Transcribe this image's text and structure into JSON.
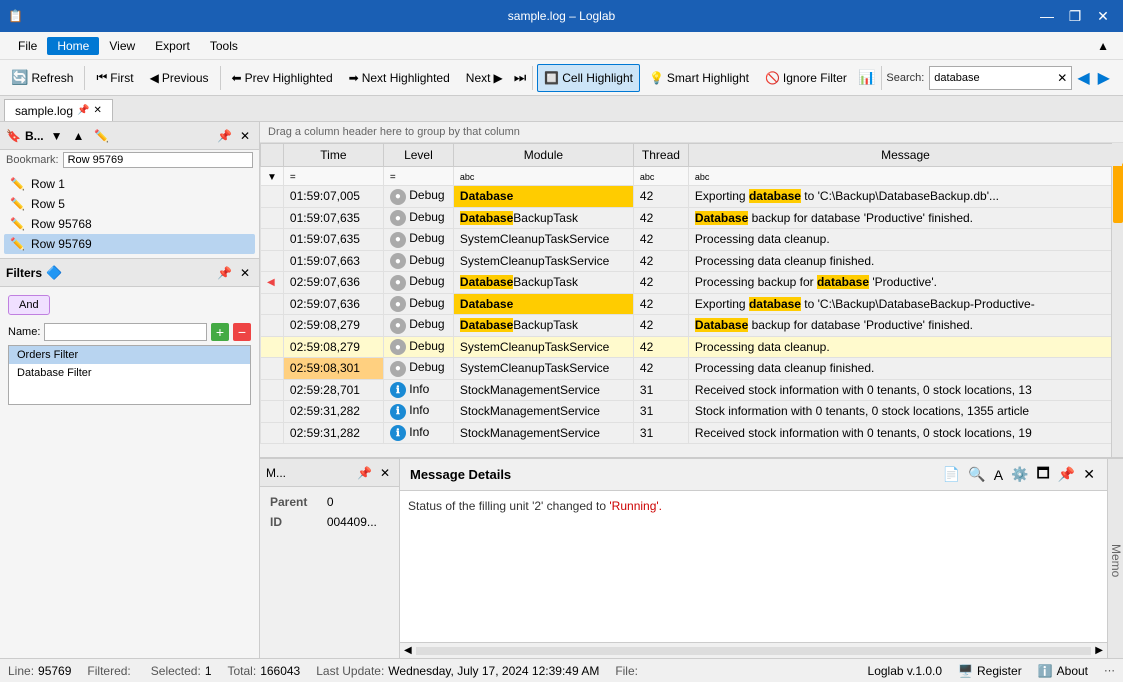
{
  "titleBar": {
    "title": "sample.log – Loglab",
    "appIcon": "📋",
    "winBtns": [
      "minimize",
      "restore",
      "close"
    ]
  },
  "menuBar": {
    "items": [
      {
        "id": "file",
        "label": "File"
      },
      {
        "id": "home",
        "label": "Home",
        "active": true
      },
      {
        "id": "view",
        "label": "View"
      },
      {
        "id": "export",
        "label": "Export"
      },
      {
        "id": "tools",
        "label": "Tools"
      }
    ],
    "collapse": "▲"
  },
  "toolbar": {
    "refresh_label": "Refresh",
    "first_label": "First",
    "previous_label": "Previous",
    "prev_highlighted_label": "Prev Highlighted",
    "next_highlighted_label": "Next Highlighted",
    "next_label": "Next",
    "cell_highlight_label": "Cell Highlight",
    "smart_highlight_label": "Smart Highlight",
    "ignore_filter_label": "Ignore Filter",
    "search_label": "Search:",
    "search_value": "database"
  },
  "tabs": [
    {
      "id": "sample-log",
      "label": "sample.log",
      "active": true,
      "pinned": true
    }
  ],
  "bookmarks": {
    "title": "B...",
    "bookmark_label": "Bookmark:",
    "bookmark_value": "Row 95769",
    "items": [
      {
        "id": "row1",
        "label": "Row 1"
      },
      {
        "id": "row5",
        "label": "Row 5"
      },
      {
        "id": "row95768",
        "label": "Row 95768"
      },
      {
        "id": "row95769",
        "label": "Row 95769",
        "selected": true
      }
    ]
  },
  "filters": {
    "title": "Filters",
    "and_label": "And",
    "name_label": "Name:",
    "name_placeholder": "",
    "items": [
      {
        "id": "orders",
        "label": "Orders Filter",
        "selected": true
      },
      {
        "id": "db",
        "label": "Database Filter"
      }
    ]
  },
  "logTable": {
    "dragHint": "Drag a column header here to group by that column",
    "columns": [
      "",
      "Time",
      "Level",
      "Module",
      "Thread",
      "Message"
    ],
    "rows": [
      {
        "id": 1,
        "time": "01:59:07,005",
        "level": "Debug",
        "module": "Database",
        "thread": "42",
        "message": "Exporting database to 'C:\\Backup\\DatabaseBackup.db'...",
        "highlight": "database",
        "moduleHighlight": true,
        "bookmark": false
      },
      {
        "id": 2,
        "time": "01:59:07,635",
        "level": "Debug",
        "module": "DatabaseBackupTask",
        "thread": "42",
        "message": "Database backup for database 'Productive' finished.",
        "highlight": "Database",
        "moduleHighlight": true,
        "bookmark": false
      },
      {
        "id": 3,
        "time": "01:59:07,635",
        "level": "Debug",
        "module": "SystemCleanupTaskService",
        "thread": "42",
        "message": "Processing data cleanup.",
        "highlight": null,
        "moduleHighlight": false,
        "bookmark": false
      },
      {
        "id": 4,
        "time": "01:59:07,663",
        "level": "Debug",
        "module": "SystemCleanupTaskService",
        "thread": "42",
        "message": "Processing data cleanup finished.",
        "highlight": null,
        "moduleHighlight": false,
        "bookmark": false
      },
      {
        "id": 5,
        "time": "02:59:07,636",
        "level": "Debug",
        "module": "DatabaseBackupTask",
        "thread": "42",
        "message": "Processing backup for database 'Productive'.",
        "highlight": "database",
        "moduleHighlight": true,
        "bookmark": true
      },
      {
        "id": 6,
        "time": "02:59:07,636",
        "level": "Debug",
        "module": "Database",
        "thread": "42",
        "message": "Exporting database to 'C:\\Backup\\DatabaseBackup-Productive-",
        "highlight": "database",
        "moduleHighlight": true,
        "bookmark": false
      },
      {
        "id": 7,
        "time": "02:59:08,279",
        "level": "Debug",
        "module": "DatabaseBackupTask",
        "thread": "42",
        "message": "Database backup for database 'Productive' finished.",
        "highlight": "Database",
        "moduleHighlight": true,
        "bookmark": false
      },
      {
        "id": 8,
        "time": "02:59:08,279",
        "level": "Debug",
        "module": "SystemCleanupTaskService",
        "thread": "42",
        "message": "Processing data cleanup.",
        "highlight": null,
        "moduleHighlight": false,
        "bookmark": false,
        "rowHighlight": true
      },
      {
        "id": 9,
        "time": "02:59:08,301",
        "level": "Debug",
        "module": "SystemCleanupTaskService",
        "thread": "42",
        "message": "Processing data cleanup finished.",
        "highlight": null,
        "moduleHighlight": false,
        "bookmark": false,
        "rowSelected": true
      },
      {
        "id": 10,
        "time": "02:59:28,701",
        "level": "Info",
        "module": "StockManagementService",
        "thread": "31",
        "message": "Received stock information with 0 tenants, 0 stock locations, 13",
        "highlight": null,
        "moduleHighlight": false,
        "bookmark": false
      },
      {
        "id": 11,
        "time": "02:59:31,282",
        "level": "Info",
        "module": "StockManagementService",
        "thread": "31",
        "message": "Stock information with 0 tenants, 0 stock locations, 1355 article",
        "highlight": null,
        "moduleHighlight": false,
        "bookmark": false
      },
      {
        "id": 12,
        "time": "02:59:31,282",
        "level": "Info",
        "module": "StockManagementService",
        "thread": "31",
        "message": "Received stock information with 0 tenants, 0 stock locations, 19",
        "highlight": null,
        "moduleHighlight": false,
        "bookmark": false
      }
    ]
  },
  "msgLeft": {
    "title": "M...",
    "fields": [
      {
        "key": "Parent",
        "value": "0"
      },
      {
        "key": "ID",
        "value": "004409..."
      }
    ]
  },
  "msgDetail": {
    "title": "Message Details",
    "content": "Status of the filling unit '2' changed to ",
    "highlight": "'Running'.",
    "icons": [
      "copy",
      "search",
      "font",
      "settings",
      "minimize",
      "pin",
      "close"
    ]
  },
  "statusBar": {
    "line_label": "Line:",
    "line_value": "95769",
    "filtered_label": "Filtered:",
    "filtered_value": "",
    "selected_label": "Selected:",
    "selected_value": "1",
    "total_label": "Total:",
    "total_value": "166043",
    "lastupdate_label": "Last Update:",
    "lastupdate_value": "Wednesday, July 17, 2024 12:39:49 AM",
    "file_label": "File:",
    "file_value": "",
    "version": "Loglab v.1.0.0",
    "register_label": "Register",
    "about_label": "About"
  },
  "memo": {
    "label": "Memo"
  }
}
